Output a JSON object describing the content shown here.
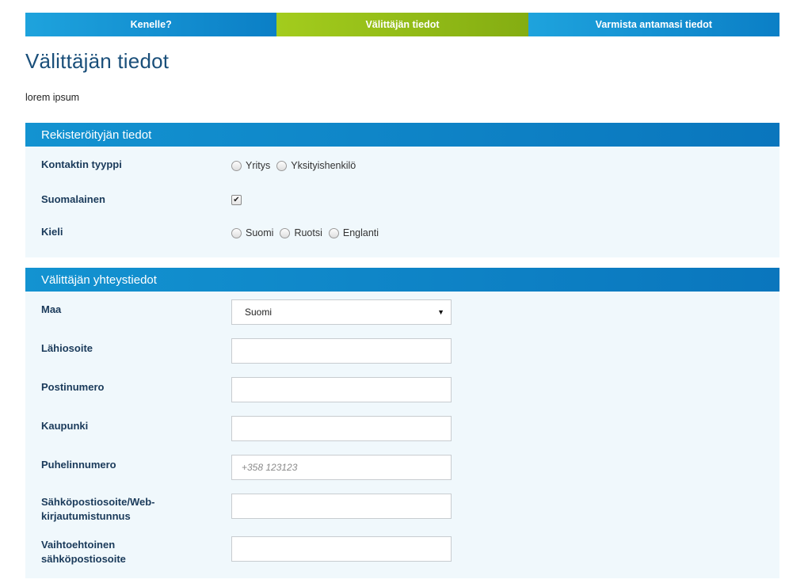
{
  "steps": [
    {
      "label": "Kenelle?"
    },
    {
      "label": "Välittäjän tiedot"
    },
    {
      "label": "Varmista antamasi tiedot"
    }
  ],
  "page_title": "Välittäjän tiedot",
  "intro_text": "lorem ipsum",
  "registrant": {
    "title": "Rekisteröityjän tiedot",
    "contact_type": {
      "label": "Kontaktin tyyppi",
      "options": [
        "Yritys",
        "Yksityishenkilö"
      ],
      "selected": null
    },
    "finnish": {
      "label": "Suomalainen",
      "checked": true
    },
    "language": {
      "label": "Kieli",
      "options": [
        "Suomi",
        "Ruotsi",
        "Englanti"
      ],
      "selected": null
    }
  },
  "contact": {
    "title": "Välittäjän yhteystiedot",
    "country": {
      "label": "Maa",
      "value": "Suomi"
    },
    "street": {
      "label": "Lähiosoite",
      "value": ""
    },
    "postal": {
      "label": "Postinumero",
      "value": ""
    },
    "city": {
      "label": "Kaupunki",
      "value": ""
    },
    "phone": {
      "label": "Puhelinnumero",
      "value": "",
      "placeholder": "+358 123123"
    },
    "email": {
      "label_line1": "Sähköpostiosoite/Web-",
      "label_line2": "kirjautumistunnus",
      "value": ""
    },
    "alt_email": {
      "label_line1": "Vaihtoehtoinen",
      "label_line2": "sähköpostiosoite",
      "value": ""
    }
  },
  "colors": {
    "step_active": "#a3cc1d",
    "step_inactive": "#1ea3dd",
    "section_header": "#1393d1",
    "section_bg": "#f0f8fc",
    "title": "#1a4f7a"
  }
}
